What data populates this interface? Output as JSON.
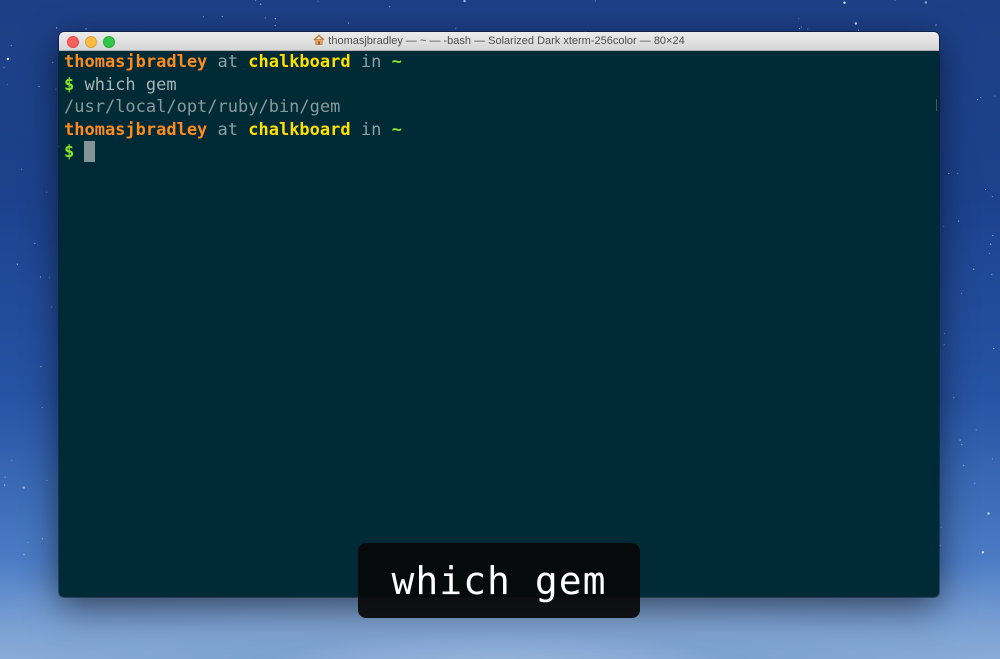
{
  "window": {
    "title": "thomasjbradley — ~ — -bash — Solarized Dark xterm-256color — 80×24",
    "title_icon": "home-folder-icon"
  },
  "terminal": {
    "prompt1": {
      "user": "thomasjbradley",
      "at": " at ",
      "host": "chalkboard",
      "in": " in ",
      "dir": "~"
    },
    "cmd_line": {
      "symbol": "$",
      "command": " which gem"
    },
    "output": "/usr/local/opt/ruby/bin/gem",
    "prompt2": {
      "user": "thomasjbradley",
      "at": " at ",
      "host": "chalkboard",
      "in": " in ",
      "dir": "~"
    },
    "input_line": {
      "symbol": "$ "
    }
  },
  "caption": {
    "text": "which gem"
  },
  "colors": {
    "terminal_bg": "#002b36",
    "user": "#ff8a1e",
    "host": "#ffe000",
    "prompt_accent": "#85e62e"
  }
}
